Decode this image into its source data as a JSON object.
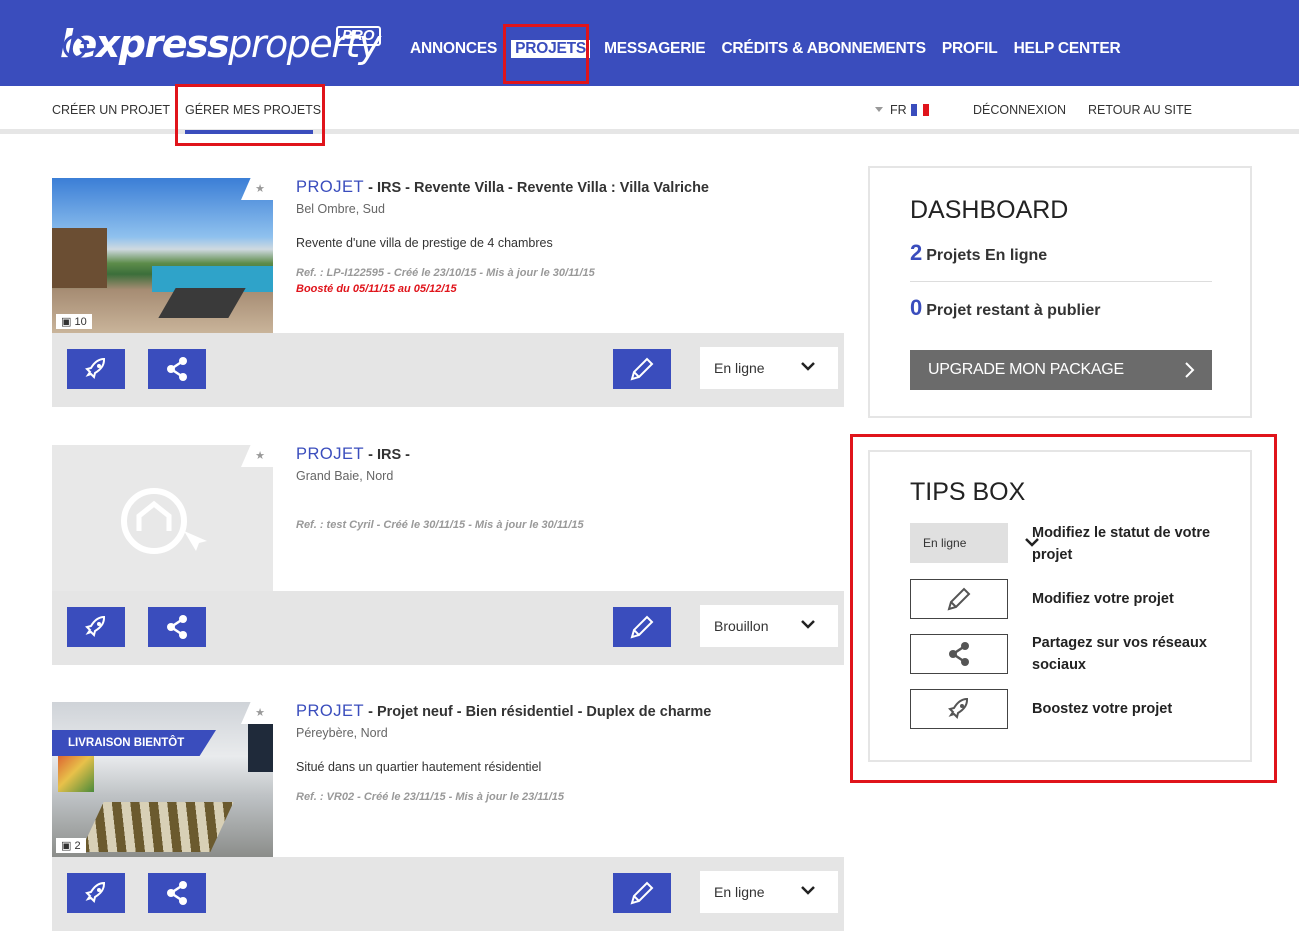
{
  "brand": {
    "logo_text_bold": "lexpress",
    "logo_text_light": "property",
    "logo_badge": "PRO",
    "accent": "#3a4dbd",
    "highlight": "#e0141b"
  },
  "nav": {
    "items": [
      "ANNONCES",
      "PROJETS",
      "MESSAGERIE",
      "CRÉDITS & ABONNEMENTS",
      "PROFIL",
      "HELP CENTER"
    ],
    "active": "PROJETS"
  },
  "subnav": {
    "create": "CRÉER UN PROJET",
    "manage": "GÉRER MES PROJETS",
    "lang": "FR",
    "logout": "DÉCONNEXION",
    "back": "RETOUR AU SITE"
  },
  "projects": [
    {
      "keyword": "PROJET",
      "title": "- IRS - Revente Villa - Revente Villa : Villa Valriche",
      "location": "Bel Ombre, Sud",
      "description": "Revente d'une villa de prestige de 4 chambres",
      "ref": "Ref. : LP-I122595 - Créé le 23/10/15 - Mis à jour le 30/11/15",
      "boost": "Boosté du 05/11/15 au 05/12/15",
      "photo_count": "10",
      "status": "En ligne",
      "star": "★"
    },
    {
      "keyword": "PROJET",
      "title": "- IRS -",
      "location": "Grand Baie, Nord",
      "description": "",
      "ref": "Ref. : test Cyril - Créé le 30/11/15 - Mis à jour le 30/11/15",
      "boost": "",
      "photo_count": "",
      "status": "Brouillon",
      "star": "★"
    },
    {
      "keyword": "PROJET",
      "title": "- Projet neuf - Bien résidentiel - Duplex de charme",
      "location": "Péreybère, Nord",
      "description": "Situé dans un quartier hautement résidentiel",
      "ref": "Ref. : VR02 - Créé le 23/11/15 - Mis à jour le 23/11/15",
      "boost": "",
      "photo_count": "2",
      "status": "En ligne",
      "star": "★",
      "banner": "LIVRAISON BIENTÔT"
    }
  ],
  "dashboard": {
    "title": "DASHBOARD",
    "online_count": "2",
    "online_label": "Projets En ligne",
    "remaining_count": "0",
    "remaining_label": "Projet restant à publier",
    "upgrade": "UPGRADE MON PACKAGE"
  },
  "tips": {
    "title": "TIPS BOX",
    "status_sample": "En ligne",
    "items": [
      "Modifiez le statut de votre projet",
      "Modifiez votre projet",
      "Partagez sur vos réseaux sociaux",
      "Boostez votre projet"
    ]
  }
}
